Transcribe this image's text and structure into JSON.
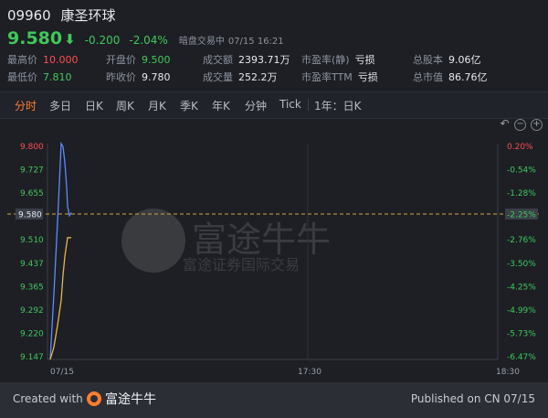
{
  "stock": {
    "code": "09960",
    "name": "康圣环球",
    "price": "9.580",
    "arrow": "⬇",
    "change": "-0.200",
    "change_pct": "-2.04%",
    "status": "暗盘交易中",
    "datetime": "07/15 16:21"
  },
  "stats": [
    {
      "label": "最高价",
      "value": "10.000",
      "color": "#ff4d4f"
    },
    {
      "label": "最低价",
      "value": "7.810",
      "color": "#3fc85b"
    },
    {
      "label": "开盘价",
      "value": "9.500",
      "color": "#3fc85b"
    },
    {
      "label": "昨收价",
      "value": "9.780",
      "color": "#e6e8ee"
    },
    {
      "label": "成交额",
      "value": "2393.71万",
      "color": "#e6e8ee"
    },
    {
      "label": "成交量",
      "value": "252.2万",
      "color": "#e6e8ee"
    },
    {
      "label": "市盈率(静)",
      "value": "亏损",
      "color": "#e6e8ee"
    },
    {
      "label": "市盈率TTM",
      "value": "亏损",
      "color": "#e6e8ee"
    },
    {
      "label": "总股本",
      "value": "9.06亿",
      "color": "#e6e8ee"
    },
    {
      "label": "总市值",
      "value": "86.76亿",
      "color": "#e6e8ee"
    }
  ],
  "tabs": [
    "分时",
    "多日",
    "日K",
    "周K",
    "月K",
    "季K",
    "年K",
    "分钟",
    "Tick",
    "1年：日K"
  ],
  "tools": {
    "undo": "↶",
    "minus": "−",
    "plus": "+"
  },
  "watermark": {
    "brand": "富途牛牛",
    "sub": "富途证券国际交易"
  },
  "chart_data": {
    "type": "line",
    "y_ticks": [
      "9.800",
      "9.727",
      "9.655",
      "9.582",
      "9.510",
      "9.437",
      "9.365",
      "9.292",
      "9.220",
      "9.147"
    ],
    "pct_ticks": [
      "0.20%",
      "-0.54%",
      "-1.28%",
      "-2.02%",
      "-2.76%",
      "-3.50%",
      "-4.25%",
      "-4.99%",
      "-5.73%",
      "-6.47%"
    ],
    "current_price_label": "9.580",
    "current_pct_label": "-2.25%",
    "x_ticks": [
      "07/15",
      "17:30",
      "18:30"
    ],
    "ylim": [
      9.1,
      9.8
    ],
    "series": [
      {
        "color": "#5b8cff",
        "values": [
          9.111,
          9.32,
          9.55,
          9.8,
          9.79,
          9.74,
          9.66,
          9.6,
          9.57,
          9.58
        ]
      },
      {
        "color": "#e9b548",
        "values": [
          9.111,
          9.15,
          9.22,
          9.3,
          9.38,
          9.44,
          9.48,
          9.5,
          9.5,
          9.5
        ]
      }
    ],
    "colors": {
      "up": "#ff4d4f",
      "down": "#3fc85b",
      "price_line": "#d9a441"
    }
  },
  "footer": {
    "created_with": "Created with",
    "brand": "富途牛牛",
    "published": "Published on CN 07/15"
  }
}
